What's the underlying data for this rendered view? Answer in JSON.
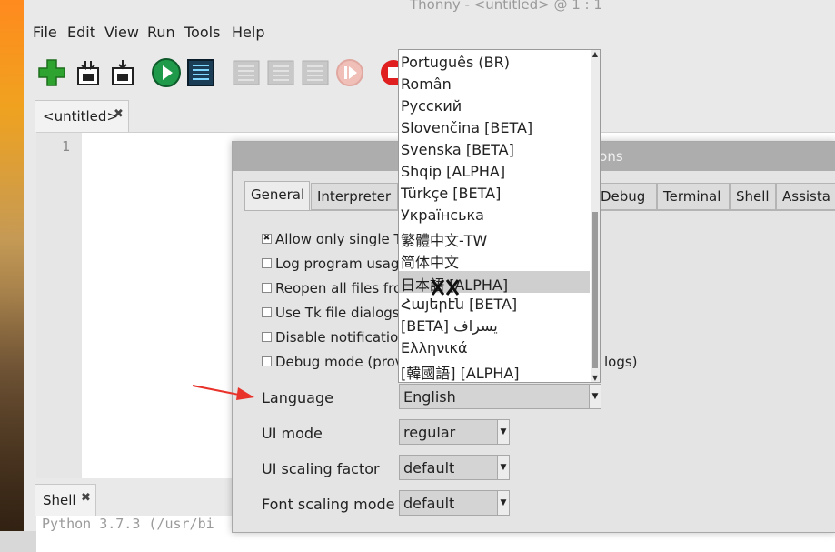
{
  "window": {
    "title": "Thonny - <untitled> @ 1 : 1"
  },
  "menubar": [
    "File",
    "Edit",
    "View",
    "Run",
    "Tools",
    "Help"
  ],
  "toolbar": {
    "icons": [
      "new-file-icon",
      "open-file-icon",
      "save-file-icon",
      "run-icon",
      "debug-icon",
      "step-over-icon",
      "step-into-icon",
      "step-out-icon",
      "resume-icon",
      "stop-icon"
    ],
    "colors": {
      "new": "#2fa32f",
      "run": "#1e9a4a",
      "debug": "#1b3d55",
      "stop": "#e02020",
      "disabled": "#b8b8b8"
    }
  },
  "editor": {
    "tab_label": "<untitled>",
    "tab_close": "✖",
    "line_numbers": [
      "1"
    ]
  },
  "shell": {
    "tab_label": "Shell",
    "tab_close": "✖",
    "text": "Python 3.7.3 (/usr/bi"
  },
  "options_dialog": {
    "title": "ions",
    "tabs": [
      "General",
      "Interpreter",
      "Debug",
      "Terminal",
      "Shell",
      "Assista"
    ],
    "active_tab": "General",
    "checkboxes": [
      {
        "label": "Allow only single T",
        "checked": true
      },
      {
        "label": "Log program usag",
        "checked": false
      },
      {
        "label": "Reopen all files fro",
        "checked": false
      },
      {
        "label": "Use Tk file dialogs",
        "checked": false
      },
      {
        "label": "Disable notification",
        "checked": false
      },
      {
        "label": "Debug mode (prov",
        "checked": false
      }
    ],
    "debug_mode_suffix": "logs)",
    "fields": {
      "language": {
        "label": "Language",
        "value": "English"
      },
      "ui_mode": {
        "label": "UI mode",
        "value": "regular"
      },
      "ui_scaling": {
        "label": "UI scaling factor",
        "value": "default"
      },
      "font_scaling": {
        "label": "Font scaling mode",
        "value": "default"
      }
    }
  },
  "language_dropdown": {
    "items": [
      "Português (BR)",
      "Român",
      "Русский",
      "Slovenčina [BETA]",
      "Svenska [BETA]",
      "Shqip [ALPHA]",
      "Türkçe [BETA]",
      "Українська",
      "繁體中文-TW",
      "简体中文",
      "日本語 [ALPHA]",
      "Հայերէն [BETA]",
      "[BETA] یسراف",
      "Ελληνικά",
      "  [韓國語] [ALPHA]"
    ],
    "highlighted_index": 10,
    "scroll_up": "▲",
    "scroll_down": "▼"
  },
  "combo_arrow": "▼",
  "checkbox_mark": "✖",
  "annotation": {
    "arrow_color": "#e8322a"
  }
}
